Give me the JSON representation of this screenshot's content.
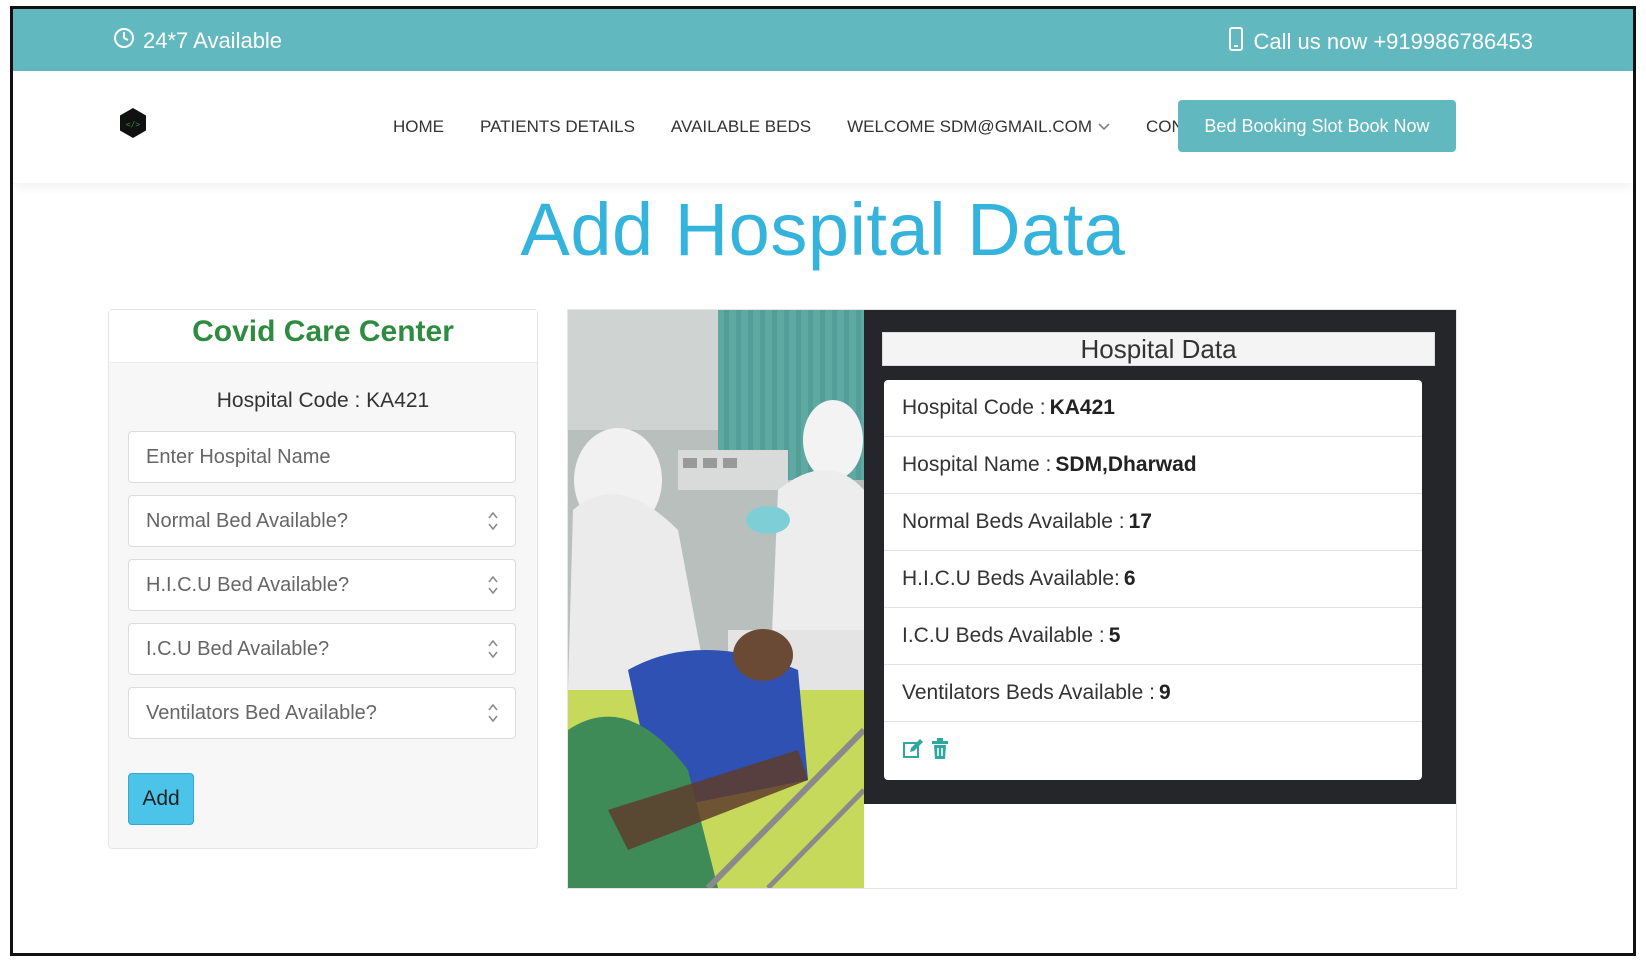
{
  "topbar": {
    "availability": "24*7 Available",
    "phone": "Call us now +919986786453"
  },
  "nav": {
    "home": "HOME",
    "patients": "PATIENTS DETAILS",
    "beds": "AVAILABLE BEDS",
    "welcome": "WELCOME SDM@GMAIL.COM",
    "contact": "CONTACT",
    "book_btn": "Bed Booking Slot Book Now"
  },
  "page": {
    "title": "Add Hospital Data"
  },
  "form": {
    "heading": "Covid Care Center",
    "code_label": "Hospital Code : KA421",
    "name_placeholder": "Enter Hospital Name",
    "normal_placeholder": "Normal Bed Available?",
    "hicu_placeholder": "H.I.C.U Bed Available?",
    "icu_placeholder": "I.C.U Bed Available?",
    "vent_placeholder": "Ventilators Bed Available?",
    "add_label": "Add"
  },
  "hospital": {
    "title": "Hospital Data",
    "rows": [
      {
        "label": "Hospital Code :",
        "value": "KA421"
      },
      {
        "label": "Hospital Name :",
        "value": "SDM,Dharwad"
      },
      {
        "label": "Normal Beds Available :",
        "value": "17"
      },
      {
        "label": "H.I.C.U Beds Available:",
        "value": "6"
      },
      {
        "label": "I.C.U Beds Available :",
        "value": "5"
      },
      {
        "label": "Ventilators Beds Available :",
        "value": "9"
      }
    ]
  },
  "colors": {
    "brand": "#62b8bf",
    "title": "#34b3dc",
    "heading_green": "#2e8b3f",
    "add_button": "#4cc3e8"
  },
  "icons": [
    "clock-icon",
    "phone-icon",
    "logo-icon",
    "chevron-down-icon",
    "edit-icon",
    "trash-icon"
  ]
}
